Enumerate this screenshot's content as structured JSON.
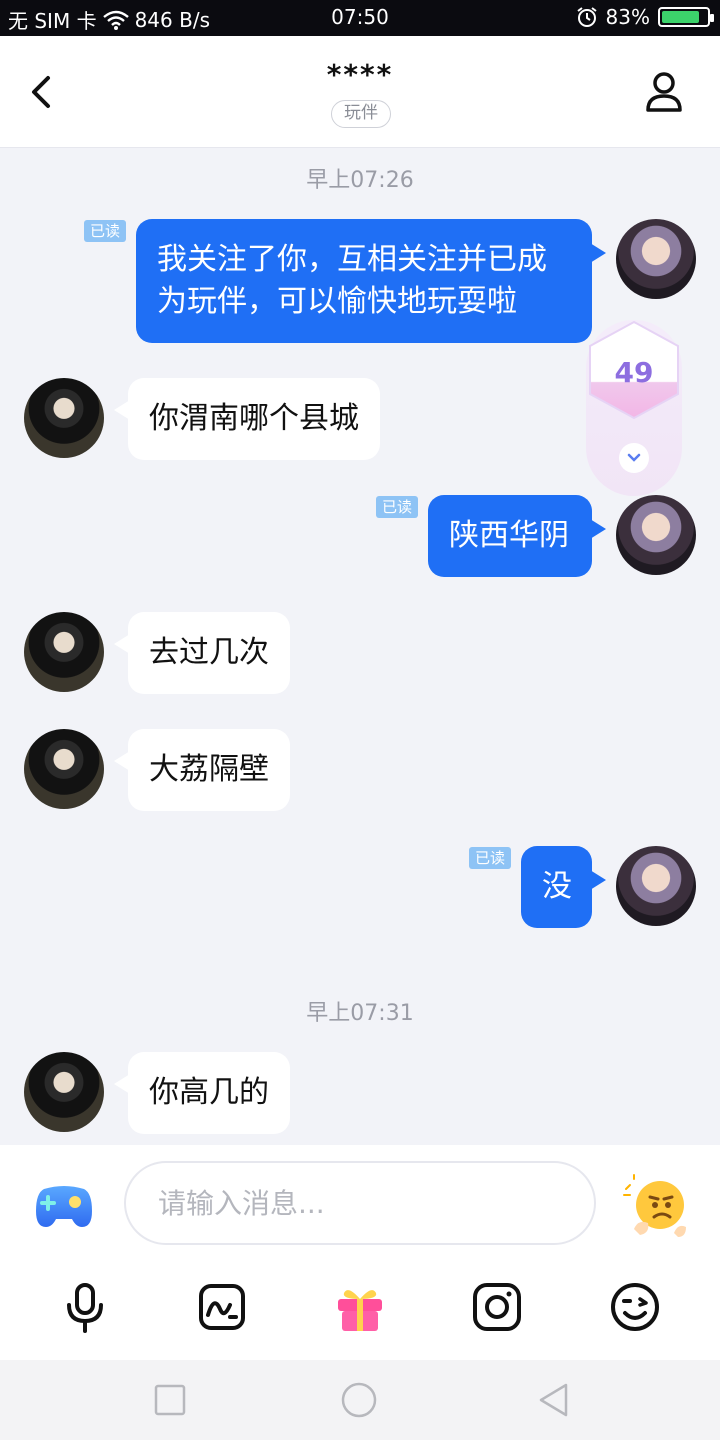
{
  "status_bar": {
    "carrier": "无 SIM 卡",
    "network_speed": "846 B/s",
    "time": "07:50",
    "battery": "83%",
    "battery_level": 0.83
  },
  "header": {
    "title": "****",
    "tag": "玩伴"
  },
  "chat": {
    "time_1": "早上07:26",
    "time_2": "早上07:31",
    "read_label": "已读",
    "messages": [
      {
        "from": "me",
        "text_1": "我关注了你，互相关注并已成",
        "text_2": "为玩伴，可以愉快地玩耍啦"
      },
      {
        "from": "other",
        "text": "你渭南哪个县城"
      },
      {
        "from": "me",
        "text": "陕西华阴"
      },
      {
        "from": "other",
        "text": "去过几次"
      },
      {
        "from": "other",
        "text": "大荔隔壁"
      },
      {
        "from": "me",
        "text": "没"
      },
      {
        "from": "other",
        "text": "你高几的"
      }
    ]
  },
  "floating_badge": {
    "value": "49"
  },
  "input_bar": {
    "placeholder": "请输入消息..."
  },
  "colors": {
    "accent": "#1f6ff5",
    "read_badge": "#8ec3f5",
    "background": "#f2f3f8"
  }
}
